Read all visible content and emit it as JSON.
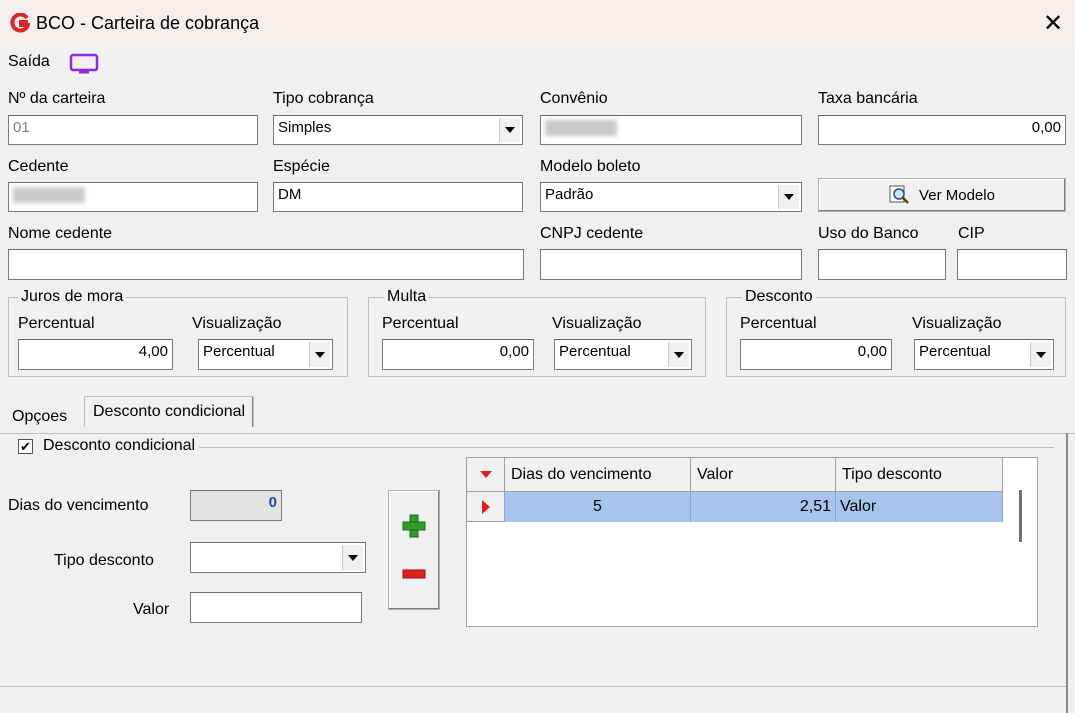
{
  "window": {
    "title": "BCO - Carteira de cobrança",
    "close_symbol": "✕"
  },
  "saida_label": "Saída",
  "fields": {
    "nro_carteira": {
      "label": "Nº da carteira",
      "value": "01"
    },
    "tipo_cobranca": {
      "label": "Tipo cobrança",
      "value": "Simples"
    },
    "convenio": {
      "label": "Convênio"
    },
    "taxa_bancaria": {
      "label": "Taxa bancária",
      "value": "0,00"
    },
    "cedente": {
      "label": "Cedente"
    },
    "especie": {
      "label": "Espécie",
      "value": "DM"
    },
    "modelo_boleto": {
      "label": "Modelo boleto",
      "value": "Padrão"
    },
    "ver_modelo": {
      "label": "Ver Modelo"
    },
    "nome_cedente": {
      "label": "Nome cedente",
      "value": ""
    },
    "cnpj_cedente": {
      "label": "CNPJ cedente",
      "value": ""
    },
    "uso_banco": {
      "label": "Uso do Banco",
      "value": ""
    },
    "cip": {
      "label": "CIP",
      "value": ""
    }
  },
  "juros": {
    "title": "Juros de mora",
    "percentual_label": "Percentual",
    "percentual": "4,00",
    "visualizacao_label": "Visualização",
    "visualizacao": "Percentual"
  },
  "multa": {
    "title": "Multa",
    "percentual_label": "Percentual",
    "percentual": "0,00",
    "visualizacao_label": "Visualização",
    "visualizacao": "Percentual"
  },
  "desconto": {
    "title": "Desconto",
    "percentual_label": "Percentual",
    "percentual": "0,00",
    "visualizacao_label": "Visualização",
    "visualizacao": "Percentual"
  },
  "tabs": [
    {
      "label": "Opçoes",
      "active": false
    },
    {
      "label": "Desconto condicional",
      "active": true
    }
  ],
  "desconto_condicional": {
    "checkbox_label": "Desconto condicional",
    "checked": true,
    "dias_label": "Dias do vencimento",
    "dias_value": "0",
    "tipo_label": "Tipo desconto",
    "tipo_value": "",
    "valor_label": "Valor",
    "valor_value": ""
  },
  "grid": {
    "headers": [
      "Dias do vencimento",
      "Valor",
      "Tipo desconto"
    ],
    "rows": [
      {
        "dias": "5",
        "valor": "2,51",
        "tipo": "Valor"
      }
    ]
  },
  "colors": {
    "accent_purple": "#8a2be2",
    "logo_red": "#d9262b",
    "row_selected": "#a8c3ec"
  }
}
